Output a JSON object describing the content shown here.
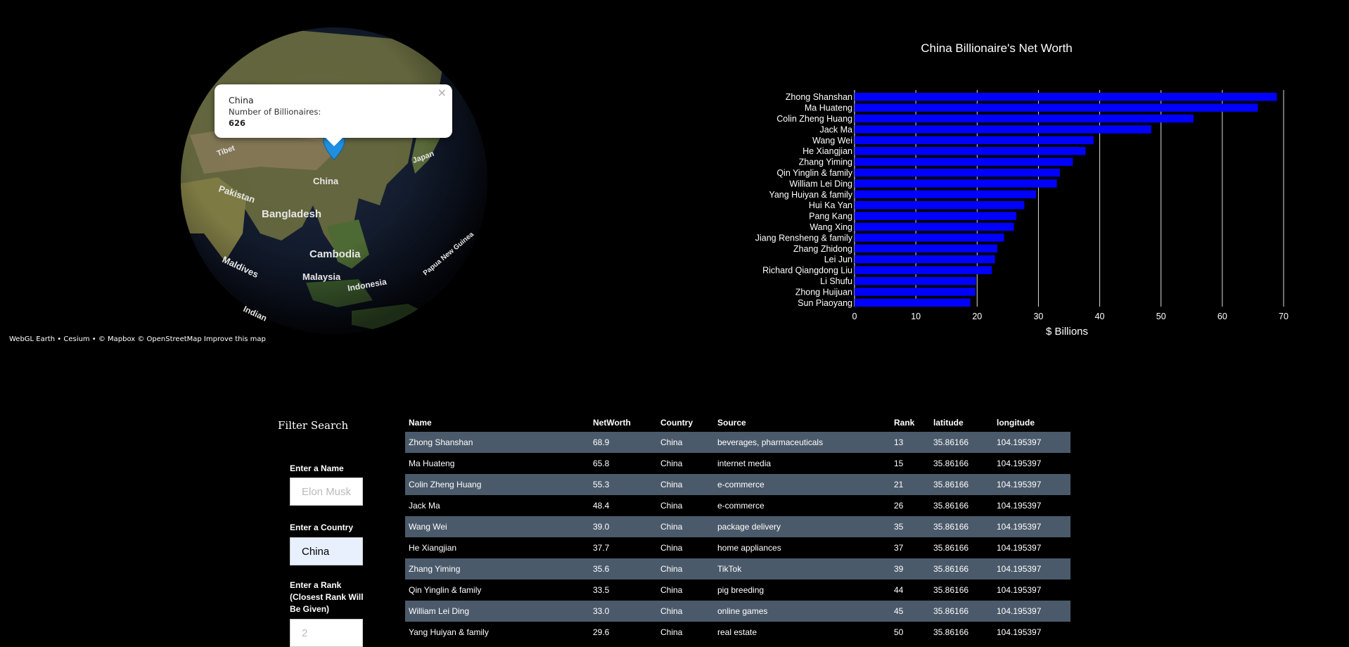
{
  "globe": {
    "attribution": "WebGL Earth • Cesium • © Mapbox © OpenStreetMap Improve this map",
    "labels": {
      "china": "China",
      "japan": "Japan",
      "pakistan": "Pakistan",
      "bangladesh": "Bangladesh",
      "cambodia": "Cambodia",
      "malaysia": "Malaysia",
      "indonesia": "Indonesia",
      "maldives": "Maldives",
      "papua": "Papua New Guinea",
      "tibet": "Tibet",
      "indian_ocean": "Indian"
    },
    "popup": {
      "country": "China",
      "label": "Number of Billionaires:",
      "count": "626",
      "close": "×"
    },
    "marker_icon": "map-pin-icon",
    "colors": {
      "ocean": "#121a2b",
      "land": "#5f6b3a",
      "marker": "#1f8fe0"
    }
  },
  "chart_data": {
    "type": "bar",
    "orientation": "horizontal",
    "title": "China Billionaire's Net Worth",
    "xlabel": "$ Billions",
    "ylabel": "",
    "xlim": [
      0,
      70
    ],
    "xticks": [
      0,
      10,
      20,
      30,
      40,
      50,
      60,
      70
    ],
    "grid": true,
    "bar_color": "#0000ff",
    "categories": [
      "Zhong Shanshan",
      "Ma Huateng",
      "Colin Zheng Huang",
      "Jack Ma",
      "Wang Wei",
      "He Xiangjian",
      "Zhang Yiming",
      "Qin Yinglin & family",
      "William Lei Ding",
      "Yang Huiyan & family",
      "Hui Ka Yan",
      "Pang Kang",
      "Wang Xing",
      "Jiang Rensheng & family",
      "Zhang Zhidong",
      "Lei Jun",
      "Richard Qiangdong Liu",
      "Li Shufu",
      "Zhong Huijuan",
      "Sun Piaoyang"
    ],
    "values": [
      68.9,
      65.8,
      55.3,
      48.4,
      39.0,
      37.7,
      35.6,
      33.5,
      33.0,
      29.6,
      27.7,
      26.4,
      26.0,
      24.4,
      23.3,
      22.9,
      22.4,
      19.8,
      19.7,
      18.9
    ]
  },
  "filter": {
    "title": "Filter Search",
    "name_label": "Enter a Name",
    "name_placeholder": "Elon Musk",
    "name_value": "",
    "country_label": "Enter a Country",
    "country_value": "China",
    "rank_label": "Enter a Rank (Closest Rank Will Be Given)",
    "rank_placeholder": "2",
    "rank_value": ""
  },
  "table": {
    "headers": [
      "Name",
      "NetWorth",
      "Country",
      "Source",
      "Rank",
      "latitude",
      "longitude"
    ],
    "rows": [
      [
        "Zhong Shanshan",
        "68.9",
        "China",
        "beverages, pharmaceuticals",
        "13",
        "35.86166",
        "104.195397"
      ],
      [
        "Ma Huateng",
        "65.8",
        "China",
        "internet media",
        "15",
        "35.86166",
        "104.195397"
      ],
      [
        "Colin Zheng Huang",
        "55.3",
        "China",
        "e-commerce",
        "21",
        "35.86166",
        "104.195397"
      ],
      [
        "Jack Ma",
        "48.4",
        "China",
        "e-commerce",
        "26",
        "35.86166",
        "104.195397"
      ],
      [
        "Wang Wei",
        "39.0",
        "China",
        "package delivery",
        "35",
        "35.86166",
        "104.195397"
      ],
      [
        "He Xiangjian",
        "37.7",
        "China",
        "home appliances",
        "37",
        "35.86166",
        "104.195397"
      ],
      [
        "Zhang Yiming",
        "35.6",
        "China",
        "TikTok",
        "39",
        "35.86166",
        "104.195397"
      ],
      [
        "Qin Yinglin & family",
        "33.5",
        "China",
        "pig breeding",
        "44",
        "35.86166",
        "104.195397"
      ],
      [
        "William Lei Ding",
        "33.0",
        "China",
        "online games",
        "45",
        "35.86166",
        "104.195397"
      ],
      [
        "Yang Huiyan & family",
        "29.6",
        "China",
        "real estate",
        "50",
        "35.86166",
        "104.195397"
      ]
    ]
  }
}
